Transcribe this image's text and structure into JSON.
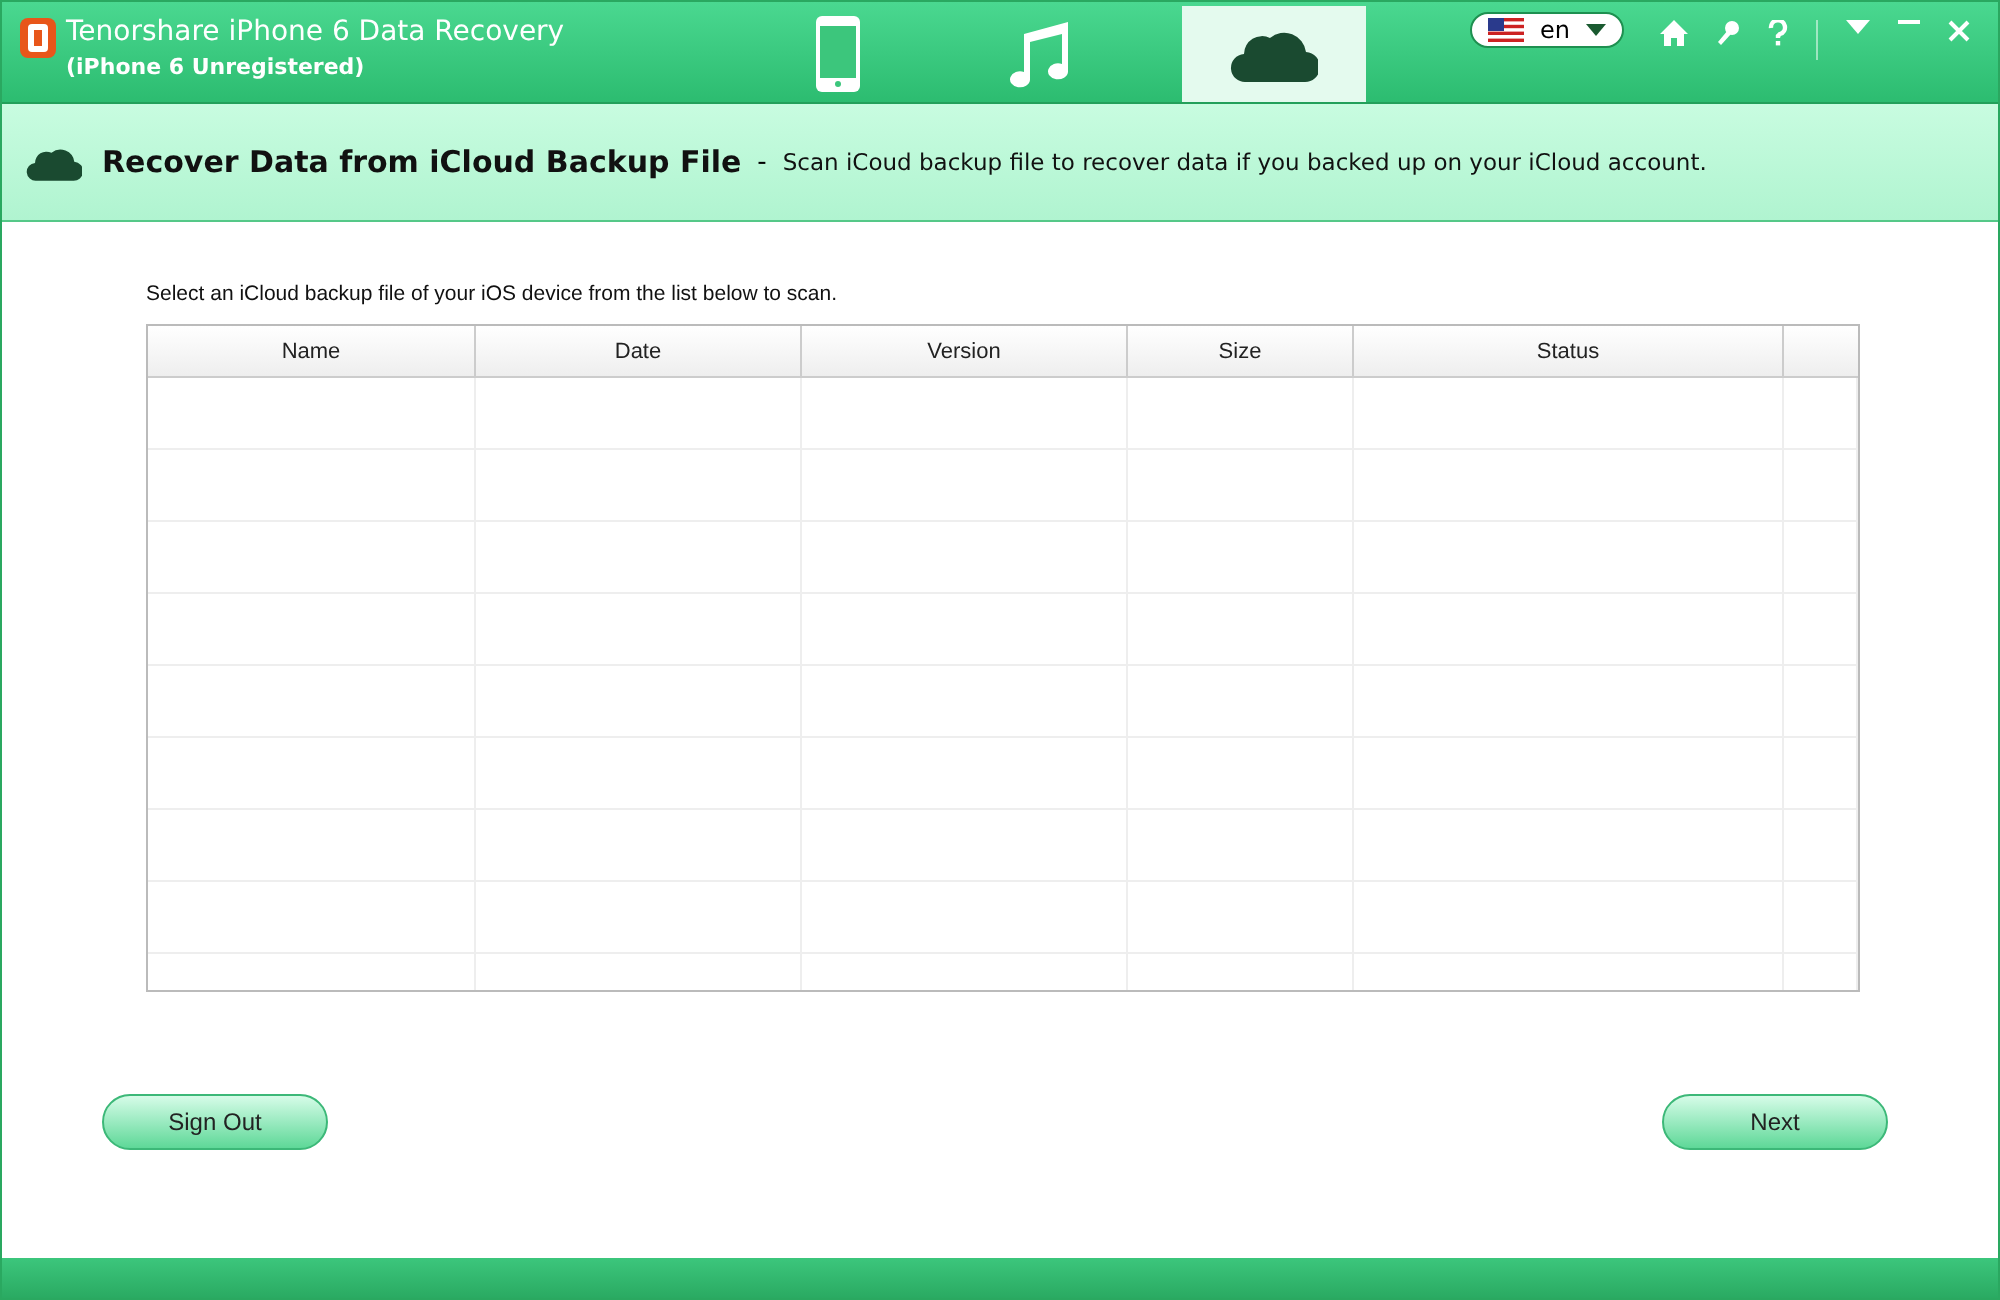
{
  "window": {
    "title": "Tenorshare iPhone 6 Data Recovery",
    "subtitle": "(iPhone 6 Unregistered)"
  },
  "tabs": [
    {
      "kind": "phone",
      "selected": false
    },
    {
      "kind": "music",
      "selected": false
    },
    {
      "kind": "cloud",
      "selected": true
    }
  ],
  "language": {
    "value": "en"
  },
  "heading": {
    "title": "Recover Data from iCloud Backup File",
    "separator": "-",
    "description": "Scan iCoud backup file to recover data if you backed up on your iCloud account."
  },
  "instruction": "Select an iCloud backup file of your iOS device from the list below to scan.",
  "table": {
    "columns": [
      "Name",
      "Date",
      "Version",
      "Size",
      "Status"
    ]
  },
  "buttons": {
    "left": "Sign Out",
    "right": "Next"
  }
}
